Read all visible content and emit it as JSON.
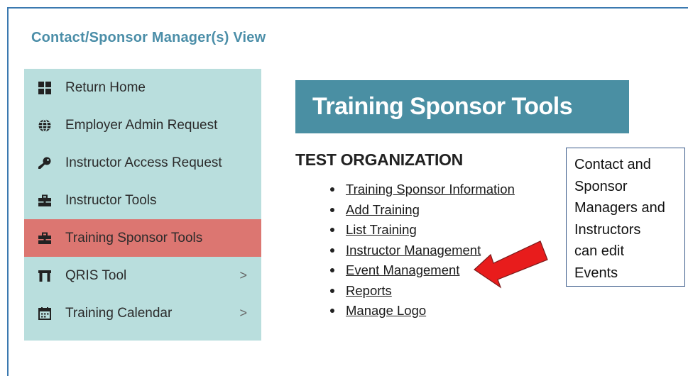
{
  "view_title": "Contact/Sponsor Manager(s) View",
  "sidebar": {
    "items": [
      {
        "label": "Return Home",
        "icon": "grid-icon",
        "active": false,
        "chevron": ""
      },
      {
        "label": "Employer Admin Request",
        "icon": "globe-icon",
        "active": false,
        "chevron": ""
      },
      {
        "label": "Instructor Access Request",
        "icon": "key-icon",
        "active": false,
        "chevron": ""
      },
      {
        "label": "Instructor Tools",
        "icon": "briefcase-icon",
        "active": false,
        "chevron": ""
      },
      {
        "label": "Training Sponsor Tools",
        "icon": "briefcase-icon",
        "active": true,
        "chevron": ""
      },
      {
        "label": "QRIS Tool",
        "icon": "building-icon",
        "active": false,
        "chevron": ">"
      },
      {
        "label": "Training Calendar",
        "icon": "calendar-icon",
        "active": false,
        "chevron": ">"
      }
    ]
  },
  "banner": {
    "title": "Training Sponsor Tools"
  },
  "organization": "TEST ORGANIZATION",
  "links": [
    "Training Sponsor Information",
    "Add Training",
    "List Training",
    "Instructor Management",
    "Event Management",
    "Reports",
    "Manage Logo"
  ],
  "callout": {
    "lines": [
      "Contact and",
      "Sponsor",
      "Managers and",
      "Instructors",
      "can edit",
      "Events"
    ]
  },
  "colors": {
    "frame_border": "#3b79b0",
    "title": "#4b8ea8",
    "sidebar_bg": "#b9dedd",
    "active_bg": "#dc7671",
    "banner_bg": "#4a8fa3",
    "arrow": "#e81c1c"
  }
}
